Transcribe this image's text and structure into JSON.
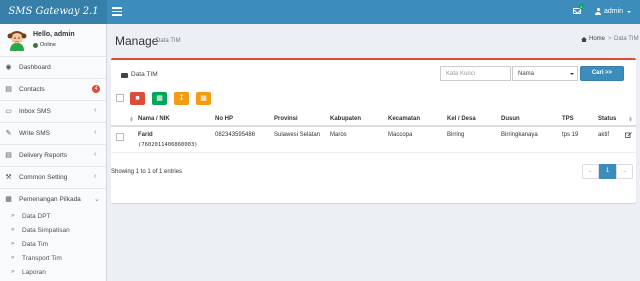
{
  "app": {
    "logo": "SMS Gateway 2.1"
  },
  "topbar": {
    "mail_count": "1",
    "user_name": "admin"
  },
  "user_panel": {
    "greeting": "Hello, admin",
    "status": "Online"
  },
  "sidebar": {
    "items": [
      {
        "label": "Dashboard",
        "icon": "dashboard-icon"
      },
      {
        "label": "Contacts",
        "icon": "contacts-icon",
        "badge": "4"
      },
      {
        "label": "Inbox SMS",
        "icon": "inbox-icon"
      },
      {
        "label": "Write SMS",
        "icon": "pencil-icon"
      },
      {
        "label": "Delivery Reports",
        "icon": "reports-icon"
      },
      {
        "label": "Common Setting",
        "icon": "wrench-icon"
      },
      {
        "label": "Pemenangan Pilkada",
        "icon": "book-icon"
      }
    ],
    "subitems": [
      {
        "label": "Data DPT"
      },
      {
        "label": "Data Simpatisan"
      },
      {
        "label": "Data Tim"
      },
      {
        "label": "Transport Tim"
      },
      {
        "label": "Laporan"
      }
    ]
  },
  "header": {
    "title": "Manage",
    "subtitle": "Data TIM",
    "breadcrumb_home": "Home",
    "breadcrumb_sep": ">",
    "breadcrumb_current": "Data TIM"
  },
  "box": {
    "title": "Data TIM",
    "search_placeholder": "Kata Kunci",
    "search_field": "Nama",
    "search_button": "Cari >>"
  },
  "table": {
    "columns": [
      "Nama / NIK",
      "No HP",
      "Provinsi",
      "Kabupaten",
      "Kecamatan",
      "Kel / Desa",
      "Dusun",
      "TPS",
      "Status"
    ],
    "rows": [
      {
        "nama": "Farid",
        "nik": "(7602011406860003)",
        "no_hp": "082343595486",
        "provinsi": "Sulawesi Selatan",
        "kabupaten": "Maros",
        "kecamatan": "Maccopa",
        "desa": "Birring",
        "dusun": "Birringkanaya",
        "tps": "tps 19",
        "status": "aktif"
      }
    ]
  },
  "footer": {
    "info": "Showing 1 to 1 of 1 entries",
    "prev": "←",
    "page": "1",
    "next": "→"
  },
  "colors": {
    "primary": "#3c8dbc",
    "danger": "#dd4b39",
    "success": "#00a65a",
    "warning": "#f39c12"
  }
}
